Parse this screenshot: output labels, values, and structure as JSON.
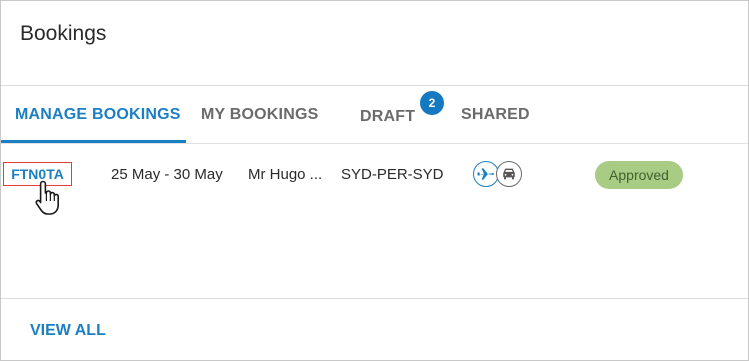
{
  "header": {
    "title": "Bookings"
  },
  "tabs": [
    {
      "label": "MANAGE BOOKINGS",
      "active": true
    },
    {
      "label": "MY BOOKINGS",
      "active": false
    },
    {
      "label": "DRAFT",
      "active": false,
      "badge": "2"
    },
    {
      "label": "SHARED",
      "active": false
    }
  ],
  "bookings": [
    {
      "ref": "FTN0TA",
      "dates": "25 May - 30 May",
      "traveller": "Mr Hugo ...",
      "route": "SYD-PER-SYD",
      "services": [
        "flight-icon",
        "car-icon"
      ],
      "status": "Approved"
    }
  ],
  "footer": {
    "view_all_label": "VIEW ALL"
  },
  "colors": {
    "accent": "#1b7fc3",
    "badge": "#1479c0",
    "approved_bg": "#a9cc85",
    "approved_text": "#40612e",
    "highlight_border": "#e53b3b"
  }
}
